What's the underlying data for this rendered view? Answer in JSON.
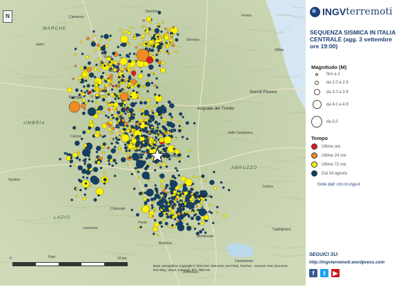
{
  "brand": {
    "ingv": "INGV",
    "terremoti": "terremoti"
  },
  "title": "SEQUENZA SISMICA IN ITALIA CENTRALE (agg. 3 settembre ore 19:00)",
  "legend": {
    "magnitude_title": "Magnitudo (M)",
    "magnitude_classes": [
      "fino a 2",
      "da 2.0 a 2.9",
      "da 3.0 a 3.9",
      "da 4.0 a 4.9",
      "da 5.0"
    ],
    "time_title": "Tempo",
    "time_classes": [
      {
        "label": "Ultime ore",
        "color": "#e31a1c"
      },
      {
        "label": "Ultime 24 ore",
        "color": "#f08a24"
      },
      {
        "label": "Ultime 72 ore",
        "color": "#fff200"
      },
      {
        "label": "Dal 24 agosto",
        "color": "#123f64"
      }
    ],
    "source_link": "fonte dati: cnt.rm.ingv.it"
  },
  "follow": {
    "label": "SEGUICI SU:",
    "url": "http://ingvterremoti.wordpress.com"
  },
  "social_icons": [
    "facebook-icon",
    "twitter-icon",
    "youtube-icon"
  ],
  "map": {
    "north_label": "N",
    "places": [
      "Norcia",
      "Arquata del Tronto",
      "Accumoli",
      "Amatrice",
      "Ascoli Piceno",
      "Cittareale",
      "Montereale",
      "Leonessa",
      "Cascia",
      "Visso",
      "Camerino",
      "Tolentino",
      "Fermo",
      "Sarnano",
      "Valle Castellana",
      "Campotosto",
      "Posta",
      "Borbona",
      "Cortino",
      "Capitignano",
      "Spoleto",
      "Rieti",
      "Antrodoco",
      "Sefro",
      "Offida"
    ],
    "regions": [
      "MARCHE",
      "UMBRIA",
      "ABRUZZO",
      "LAZIO"
    ],
    "scale_labels": [
      "0",
      "10 km"
    ],
    "credits": "Base cartografica: Copyright © 2012 Esri, DeLorme, NAVTEQ, TomTom · Sources: Esri, DeLorme, NAVTEQ, USGS, Intermap, iPC, NRCAN"
  },
  "colors": {
    "sea": "#d5e7f2",
    "land": "#c9d6b3",
    "terrain_dark": "#a9bb8f",
    "brand": "#1d3f74"
  }
}
